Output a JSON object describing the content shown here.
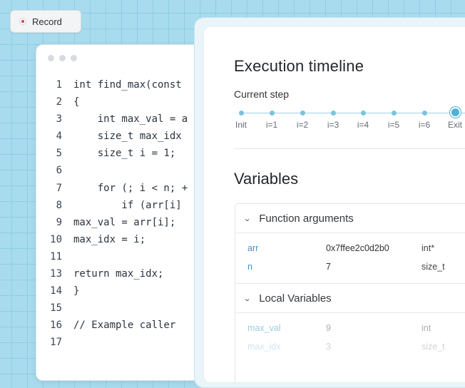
{
  "record": {
    "label": "Record"
  },
  "code": {
    "lines": [
      {
        "num": "1",
        "text": "int find_max(const"
      },
      {
        "num": "2",
        "text": "{"
      },
      {
        "num": "3",
        "text": "    int max_val = a"
      },
      {
        "num": "4",
        "text": "    size_t max_idx"
      },
      {
        "num": "5",
        "text": "    size_t i = 1;"
      },
      {
        "num": "6",
        "text": ""
      },
      {
        "num": "7",
        "text": "    for (; i < n; +"
      },
      {
        "num": "8",
        "text": "        if (arr[i]"
      },
      {
        "num": "9",
        "text": "max_val = arr[i];"
      },
      {
        "num": "10",
        "text": "max_idx = i;"
      },
      {
        "num": "11",
        "text": ""
      },
      {
        "num": "13",
        "text": "return max_idx;"
      },
      {
        "num": "14",
        "text": "}"
      },
      {
        "num": "15",
        "text": ""
      },
      {
        "num": "16",
        "text": "// Example caller"
      },
      {
        "num": "17",
        "text": ""
      }
    ]
  },
  "timeline": {
    "title": "Execution timeline",
    "step_label": "Current step",
    "steps": [
      "Init",
      "i=1",
      "i=2",
      "i=3",
      "i=4",
      "i=5",
      "i=6",
      "Exit"
    ],
    "current_index": 7
  },
  "variables": {
    "title": "Variables",
    "sections": [
      {
        "title": "Function arguments",
        "rows": [
          {
            "name": "arr",
            "value": "0x7ffee2c0d2b0",
            "type": "int*"
          },
          {
            "name": "n",
            "value": "7",
            "type": "size_t"
          }
        ]
      },
      {
        "title": "Local Variables",
        "rows": [
          {
            "name": "max_val",
            "value": "9",
            "type": "int"
          },
          {
            "name": "max_idx",
            "value": "3",
            "type": "size_t"
          }
        ]
      }
    ]
  },
  "colors": {
    "accent": "#4eb1d6",
    "background": "#a8dbee",
    "record_dot": "#e23b3b"
  }
}
